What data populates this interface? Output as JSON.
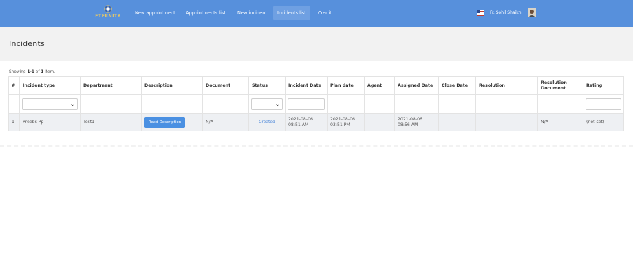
{
  "brand": {
    "name": "ETERNITY"
  },
  "nav": {
    "items": [
      {
        "label": "New appointment"
      },
      {
        "label": "Appointments list"
      },
      {
        "label": "New incident"
      },
      {
        "label": "Incidents list"
      },
      {
        "label": "Credit"
      }
    ],
    "active_index": 3,
    "user_name": "Fr. Sohil Shaikh"
  },
  "page": {
    "title": "Incidents"
  },
  "summary": {
    "prefix": "Showing ",
    "range": "1-1",
    "middle": " of ",
    "count": "1",
    "suffix": " item."
  },
  "table": {
    "headers": [
      "#",
      "Incident type",
      "Department",
      "Description",
      "Document",
      "Status",
      "Incident Date",
      "Plan date",
      "Agent",
      "Assigned Date",
      "Close Date",
      "Resolution",
      "Resolution Document",
      "Rating"
    ],
    "rows": [
      {
        "num": "1",
        "incident_type": "Preebs Pp",
        "department": "Test1",
        "description_button": "Read Description",
        "document": "N/A",
        "status": "Created",
        "incident_date": "2021-08-06 08:51 AM",
        "plan_date": "2021-08-06 03:51 PM",
        "agent": "",
        "assigned_date": "2021-08-06 08:56 AM",
        "close_date": "",
        "resolution": "",
        "resolution_document": "N/A",
        "rating": "(not set)"
      }
    ]
  },
  "colors": {
    "navbar": "#5790dc",
    "active_nav": "#6fa0e2",
    "button": "#4a90e2",
    "brand_text": "#e6c766"
  }
}
